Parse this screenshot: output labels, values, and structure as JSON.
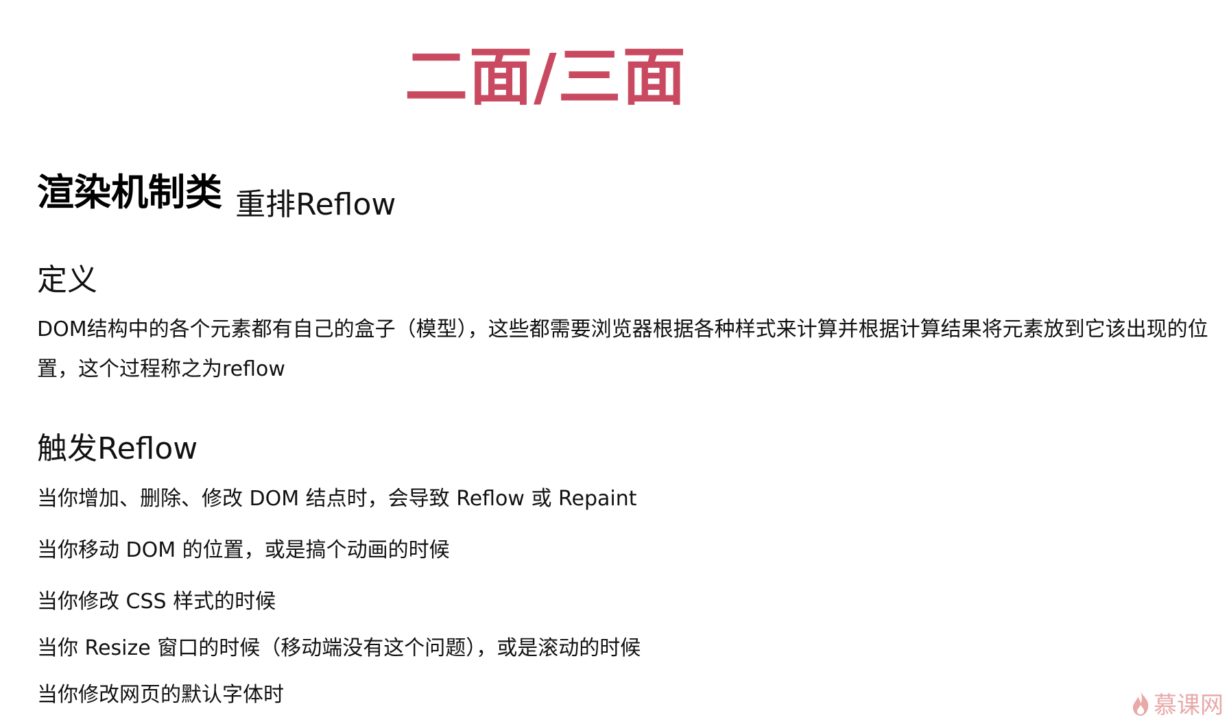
{
  "title": "二面/三面",
  "section": {
    "title": "渲染机制类",
    "subtitle": "重排Reflow"
  },
  "definition": {
    "heading": "定义",
    "text": "DOM结构中的各个元素都有自己的盒子（模型），这些都需要浏览器根据各种样式来计算并根据计算结果将元素放到它该出现的位置，这个过程称之为reflow"
  },
  "triggers": {
    "heading": "触发Reflow",
    "items": [
      "当你增加、删除、修改 DOM 结点时，会导致 Reflow 或 Repaint",
      "当你移动 DOM 的位置，或是搞个动画的时候",
      "当你修改 CSS 样式的时候",
      "当你 Resize 窗口的时候（移动端没有这个问题），或是滚动的时候",
      "当你修改网页的默认字体时"
    ]
  },
  "watermark": {
    "text": "慕课网",
    "icon": "flame-icon",
    "color": "#e8a9a9"
  },
  "colors": {
    "title": "#c94a60",
    "text": "#111111",
    "background": "#ffffff"
  }
}
